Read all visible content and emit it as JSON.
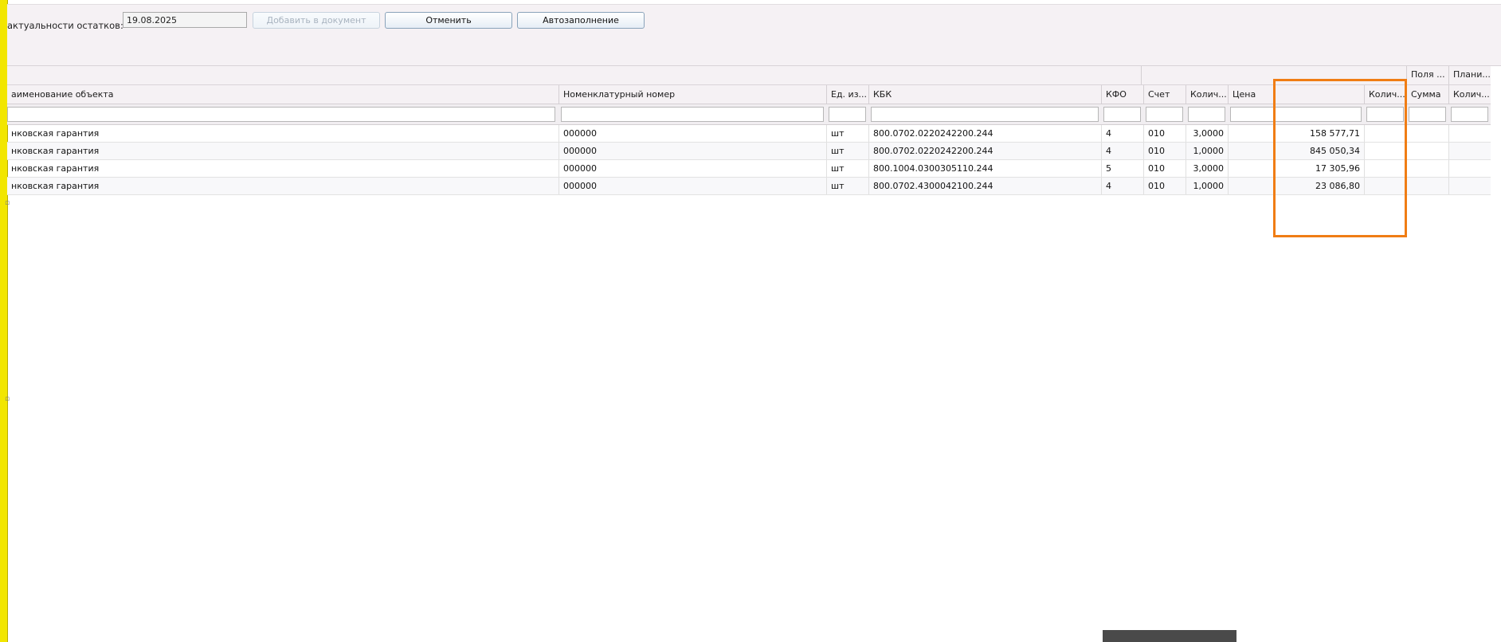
{
  "toolbar": {
    "date_label": "актуальности остатков:",
    "date_value": "19.08.2025",
    "add_label": "Добавить в документ",
    "cancel_label": "Отменить",
    "autofill_label": "Автозаполнение"
  },
  "table": {
    "group_headers": [
      "Поля ...",
      "Плани..."
    ],
    "columns": [
      "аименование объекта",
      "Номенклатурный номер",
      "Ед. из...",
      "КБК",
      "КФО",
      "Счет",
      "Колич...",
      "Цена",
      "Колич...",
      "Сумма",
      "Колич..."
    ],
    "rows": [
      {
        "name": "нковская гарантия",
        "nomenclature": "000000",
        "unit": "шт",
        "kbk": "800.0702.0220242200.244",
        "kfo": "4",
        "account": "010",
        "qty": "3,0000",
        "price": "158 577,71"
      },
      {
        "name": "нковская гарантия",
        "nomenclature": "000000",
        "unit": "шт",
        "kbk": "800.0702.0220242200.244",
        "kfo": "4",
        "account": "010",
        "qty": "1,0000",
        "price": "845 050,34"
      },
      {
        "name": "нковская гарантия",
        "nomenclature": "000000",
        "unit": "шт",
        "kbk": "800.1004.0300305110.244",
        "kfo": "5",
        "account": "010",
        "qty": "3,0000",
        "price": "17 305,96"
      },
      {
        "name": "нковская гарантия",
        "nomenclature": "000000",
        "unit": "шт",
        "kbk": "800.0702.4300042100.244",
        "kfo": "4",
        "account": "010",
        "qty": "1,0000",
        "price": "23 086,80"
      }
    ]
  },
  "colors": {
    "highlight": "#f07d14",
    "left_bar": "#f2e600"
  }
}
